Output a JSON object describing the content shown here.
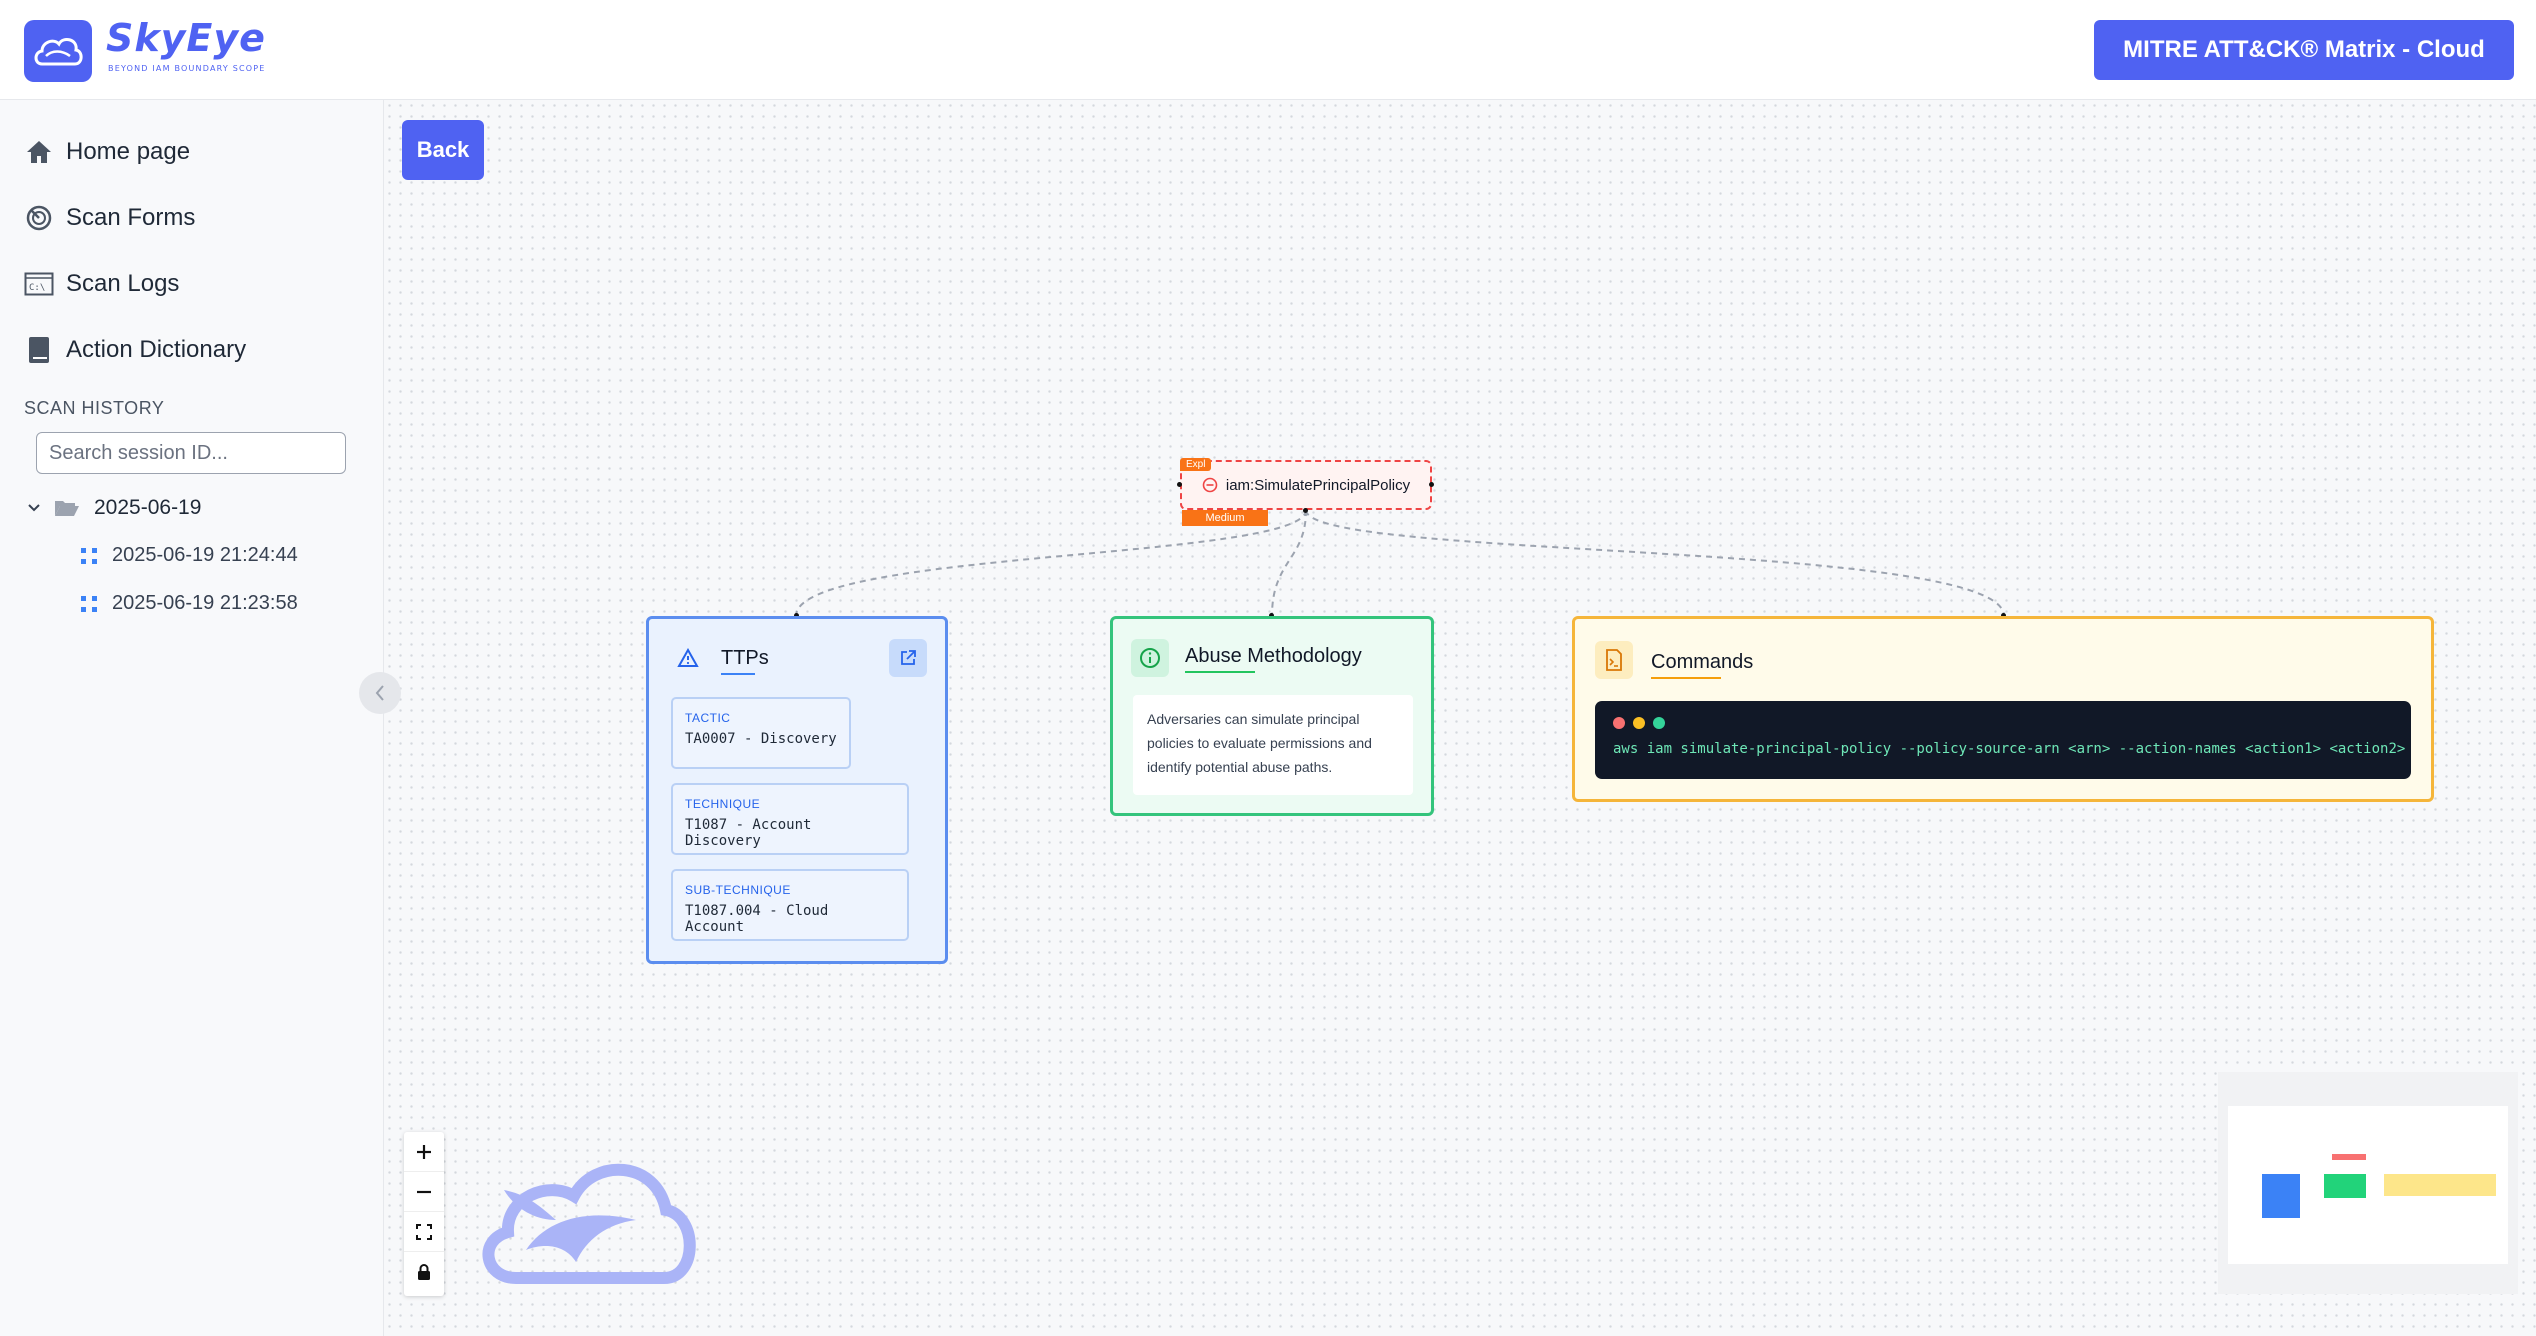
{
  "header": {
    "logo_text": "SkyEye",
    "logo_tagline": "BEYOND IAM BOUNDARY SCOPE",
    "mitre_button": "MITRE ATT&CK® Matrix - Cloud"
  },
  "sidebar": {
    "nav": [
      {
        "label": "Home page",
        "icon": "home-icon"
      },
      {
        "label": "Scan Forms",
        "icon": "radar-icon"
      },
      {
        "label": "Scan Logs",
        "icon": "terminal-icon"
      },
      {
        "label": "Action Dictionary",
        "icon": "book-icon"
      }
    ],
    "scan_history_title": "SCAN HISTORY",
    "search_placeholder": "Search session ID...",
    "tree": {
      "folder": "2025-06-19",
      "sessions": [
        "2025-06-19 21:24:44",
        "2025-06-19 21:23:58"
      ]
    }
  },
  "canvas": {
    "back_button": "Back",
    "root_node": {
      "tag": "Expl",
      "label": "iam:SimulatePrincipalPolicy",
      "severity": "Medium"
    },
    "ttps": {
      "title": "TTPs",
      "items": [
        {
          "label": "TACTIC",
          "value": "TA0007 - Discovery"
        },
        {
          "label": "TECHNIQUE",
          "value": "T1087 - Account Discovery"
        },
        {
          "label": "SUB-TECHNIQUE",
          "value": "T1087.004 - Cloud Account"
        }
      ]
    },
    "abuse": {
      "title": "Abuse Methodology",
      "description": "Adversaries can simulate principal policies to evaluate permissions and identify potential abuse paths."
    },
    "commands": {
      "title": "Commands",
      "command": "aws iam simulate-principal-policy --policy-source-arn <arn> --action-names <action1> <action2>"
    }
  },
  "colors": {
    "brand": "#4f62f2",
    "ttps_border": "#5b8def",
    "abuse_border": "#34c47c",
    "commands_border": "#f5b53a",
    "severity": "#f97316",
    "root_border": "#ef4444"
  }
}
